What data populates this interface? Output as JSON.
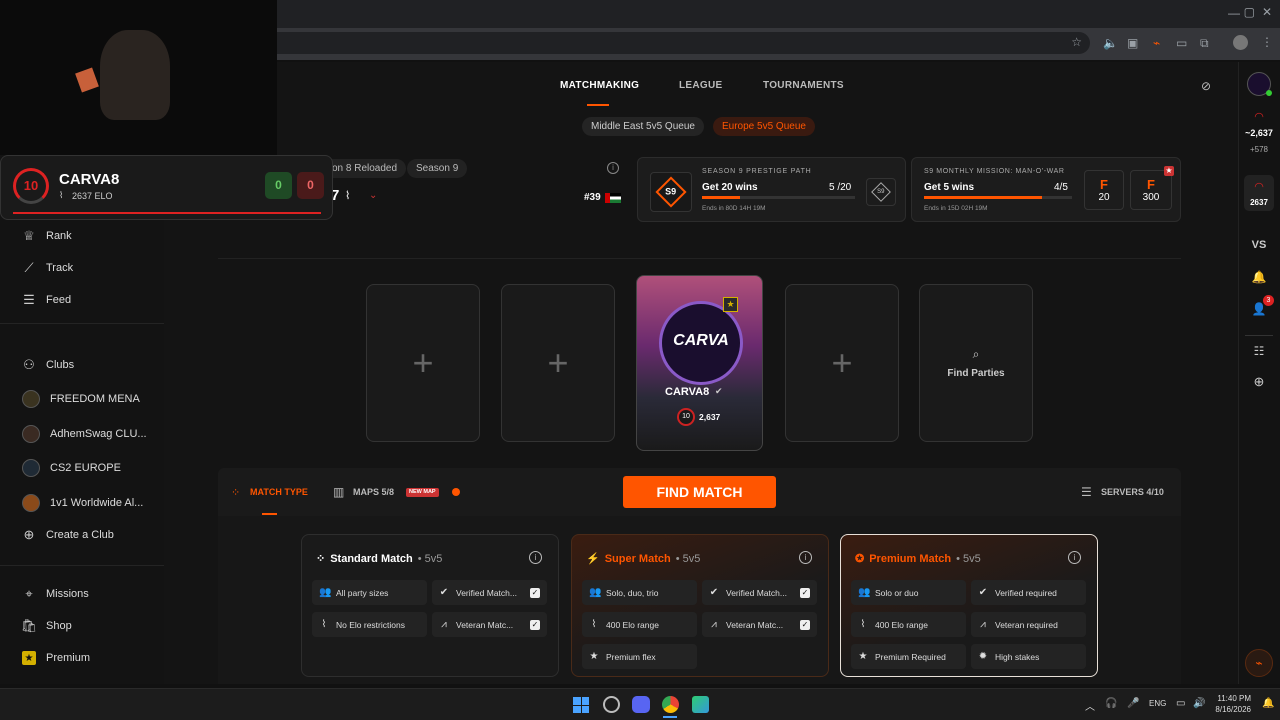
{
  "nav": {
    "tabs": [
      "MATCHMAKING",
      "LEAGUE",
      "TOURNAMENTS"
    ]
  },
  "queues": {
    "middle_east": "Middle East 5v5 Queue",
    "europe": "Europe 5v5 Queue"
  },
  "season": {
    "reloaded_label": "on 8 Reloaded",
    "season_label": "Season 9",
    "rank_frag": "7",
    "position": "#39"
  },
  "prestige": {
    "title": "SEASON 9 PRESTIGE PATH",
    "badge": "S9",
    "task": "Get 20 wins",
    "progress": "5 /20",
    "progress_fraction": 0.25,
    "ends": "Ends in 80D 14H 19M"
  },
  "mission": {
    "title": "S9 MONTHLY MISSION: MAN-O'-WAR",
    "task": "Get 5 wins",
    "progress": "4/5",
    "progress_fraction": 0.8,
    "ends": "Ends in 15D 02H 19M",
    "reward1": "20",
    "reward2": "300",
    "reward_letter": "F"
  },
  "overlay": {
    "level": "10",
    "name": "CARVA8",
    "elo": "2637 ELO",
    "score1": "0",
    "score2": "0"
  },
  "sidebar": {
    "rank": "Rank",
    "track": "Track",
    "feed": "Feed",
    "clubs": "Clubs",
    "club_items": [
      "FREEDOM MENA",
      "AdhemSwag CLU...",
      "CS2 EUROPE",
      "1v1 Worldwide Al..."
    ],
    "create_club": "Create a Club",
    "missions": "Missions",
    "shop": "Shop",
    "premium": "Premium"
  },
  "party": {
    "player_name": "CARVA8",
    "player_level": "10",
    "player_elo": "2,637",
    "logo_text": "CARVA",
    "find_parties": "Find Parties"
  },
  "toolbar": {
    "match_type": "MATCH TYPE",
    "maps": "MAPS 5/8",
    "new_map": "NEW MAP",
    "find_match": "FIND MATCH",
    "servers": "SERVERS 4/10"
  },
  "match_types": {
    "standard": {
      "name": "Standard Match",
      "mode": "• 5v5",
      "features": [
        "All party sizes",
        "Verified Match...",
        "No Elo restrictions",
        "Veteran Matc..."
      ]
    },
    "super": {
      "name": "Super Match",
      "mode": "• 5v5",
      "features": [
        "Solo, duo, trio",
        "Verified Match...",
        "400 Elo range",
        "Veteran Matc...",
        "Premium flex"
      ]
    },
    "premium": {
      "name": "Premium Match",
      "mode": "• 5v5",
      "features": [
        "Solo or duo",
        "Verified required",
        "400 Elo range",
        "Veteran required",
        "Premium Required",
        "High stakes"
      ]
    }
  },
  "rightbar": {
    "elo": "~2,637",
    "delta": "+578",
    "elo2": "2637",
    "vs": "VS",
    "notif_count": "3"
  },
  "taskbar": {
    "lang": "ENG",
    "time": "11:40 PM",
    "date": "8/16/2026"
  },
  "colors": {
    "accent": "#ff5500",
    "win_green": "#1f4a25",
    "loss_red": "#4a1a1a"
  }
}
